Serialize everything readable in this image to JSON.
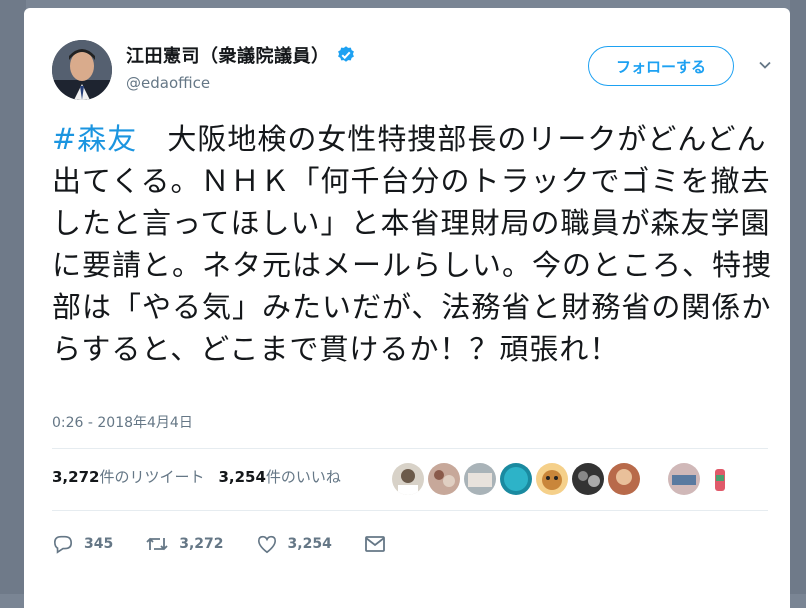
{
  "user": {
    "display_name": "江田憲司（衆議院議員）",
    "handle": "@edaoffice"
  },
  "follow_button": {
    "label": "フォローする"
  },
  "tweet": {
    "hashtag": "#森友",
    "body": "　大阪地検の女性特捜部長のリークがどんどん出てくる。ＮＨＫ「何千台分のトラックでゴミを撤去したと言ってほしい」と本省理財局の職員が森友学園に要請と。ネタ元はメールらしい。今のところ、特捜部は「やる気」みたいだが、法務省と財務省の関係からすると、どこまで貫けるか！？頑張れ！",
    "timestamp": "0:26 - 2018年4月4日"
  },
  "stats": {
    "retweets_count": "3,272",
    "retweets_label": "件のリツイート",
    "likes_count": "3,254",
    "likes_label": "件のいいね"
  },
  "actions": {
    "reply_count": "345",
    "retweet_count": "3,272",
    "like_count": "3,254"
  },
  "colors": {
    "accent": "#1da1f2",
    "hashtag": "#1b95e0",
    "text": "#14171a",
    "muted": "#657786"
  }
}
